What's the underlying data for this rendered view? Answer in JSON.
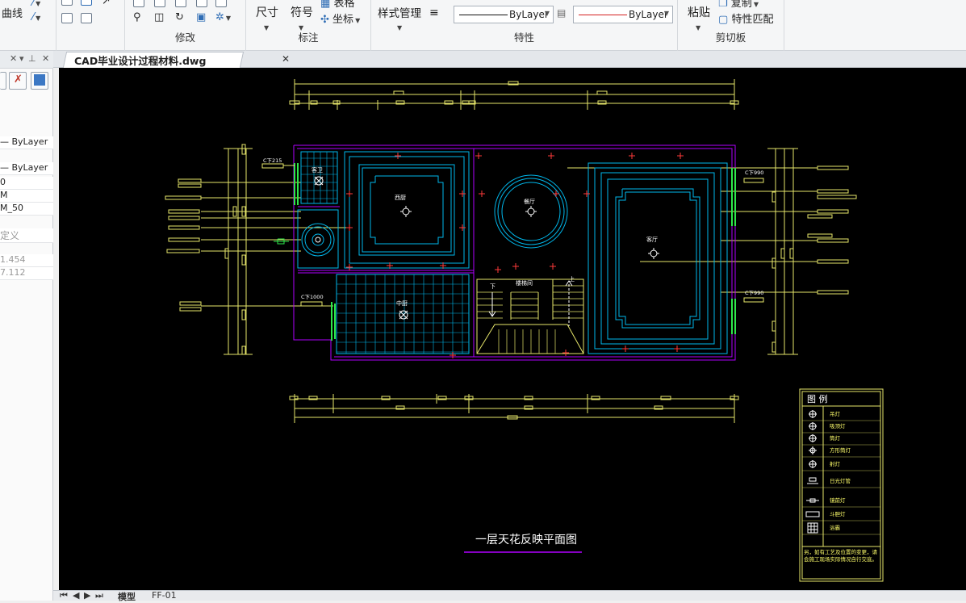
{
  "ribbon": {
    "draw": {
      "curve": "曲线"
    },
    "groups": {
      "modify": "修改",
      "annotate": "标注",
      "properties": "特性",
      "clipboard": "剪切板"
    },
    "annotate": {
      "dimension": "尺寸",
      "symbol": "符号",
      "coordinate": "坐标",
      "table": "表格"
    },
    "properties": {
      "style_manager": "样式管理",
      "linetype_value": "ByLayer",
      "color_value": "ByLayer"
    },
    "clipboard": {
      "paste": "粘贴",
      "copy": "复制",
      "match_props": "特性匹配"
    }
  },
  "left_panel": {
    "rows": [
      "ByLayer",
      "ByLayer",
      "0",
      "M",
      "M_50",
      "定义",
      "1.454",
      "7.112"
    ]
  },
  "doc_tab": {
    "title": "CAD毕业设计过程材料.dwg",
    "close": "✕"
  },
  "drawing": {
    "title": "一层天花反映平面图",
    "rooms": {
      "bath": "客卫",
      "west_kitchen": "西厨",
      "dining": "餐厅",
      "living": "客厅",
      "chinese_kitchen": "中厨",
      "stair": "楼梯间",
      "down": "下",
      "up": "上"
    },
    "ceiling_notes": [
      "C下215",
      "C下990",
      "C下990",
      "C下1000"
    ],
    "legend": {
      "title": "图 例",
      "items": [
        "吊灯",
        "吸顶灯",
        "筒灯",
        "方形筒灯",
        "射灯",
        "日光灯管",
        "镜前灯",
        "斗胆灯",
        "浴霸"
      ],
      "note": "另，如有工艺及位置的变更，请会施工现场实际情况自行交底。"
    }
  },
  "bottom_tabs": {
    "model": "模型",
    "layout": "FF-01"
  },
  "colors": {
    "canvas": "#000000",
    "wall": "#b100ff",
    "cyan": "#00b7eb",
    "yellow": "#ffff6b",
    "red": "#ff3a3a"
  }
}
